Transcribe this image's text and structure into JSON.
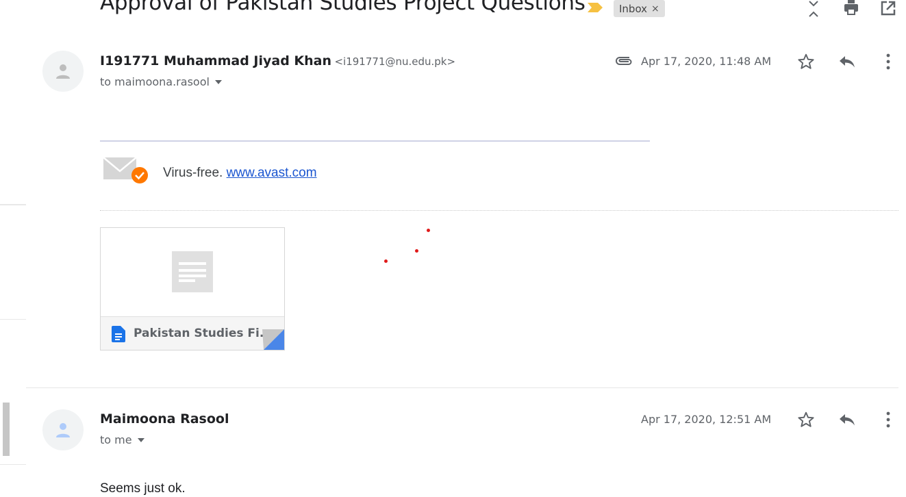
{
  "subject": "Approval of Pakistan Studies Project Questions",
  "label_chip": "Inbox",
  "label_chip_close": "×",
  "icons": {
    "expand": "expand-collapse-icon",
    "print": "print-icon",
    "open_new": "open-in-new-window-icon",
    "important": "important-marker-icon"
  },
  "colors": {
    "important": "#f6c142",
    "link": "#1a55d0",
    "avast_badge": "#ff7800"
  },
  "messages": [
    {
      "sender_name": "I191771 Muhammad Jiyad Khan",
      "sender_email": "<i191771@nu.edu.pk>",
      "to": "to maimoona.rasool",
      "date": "Apr 17, 2020, 11:48 AM",
      "has_attachment_icon": true,
      "virus_prefix": "Virus-free.",
      "virus_link": "www.avast.com",
      "attachment_name": "Pakistan Studies Fi..."
    },
    {
      "sender_name": "Maimoona Rasool",
      "to": "to me",
      "date": "Apr 17, 2020, 12:51 AM",
      "body": "Seems just ok."
    }
  ]
}
